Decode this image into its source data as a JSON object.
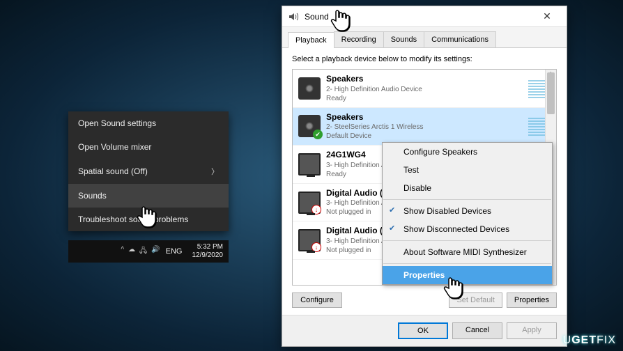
{
  "dark_menu": {
    "items": [
      {
        "label": "Open Sound settings"
      },
      {
        "label": "Open Volume mixer"
      },
      {
        "label": "Spatial sound (Off)",
        "arrow": true
      },
      {
        "label": "Sounds",
        "hover": true
      },
      {
        "label": "Troubleshoot sound problems"
      }
    ]
  },
  "taskbar": {
    "lang": "ENG",
    "time": "5:32 PM",
    "date": "12/9/2020"
  },
  "sound_dialog": {
    "title": "Sound",
    "tabs": [
      "Playback",
      "Recording",
      "Sounds",
      "Communications"
    ],
    "active_tab": 0,
    "instruction": "Select a playback device below to modify its settings:",
    "devices": [
      {
        "name": "Speakers",
        "sub1": "2- High Definition Audio Device",
        "sub2": "Ready",
        "icon": "speaker",
        "meter": true
      },
      {
        "name": "Speakers",
        "sub1": "2- SteelSeries Arctis 1 Wireless",
        "sub2": "Default Device",
        "icon": "speaker",
        "meter": true,
        "selected": true,
        "badge": "check"
      },
      {
        "name": "24G1WG4",
        "sub1": "3- High Definition Audio Device",
        "sub2": "Ready",
        "icon": "monitor",
        "meter": true
      },
      {
        "name": "Digital Audio (S/PDIF)",
        "sub1": "3- High Definition Audio Device",
        "sub2": "Not plugged in",
        "icon": "monitor",
        "badge": "down"
      },
      {
        "name": "Digital Audio (S/PDIF)",
        "sub1": "3- High Definition Audio Device",
        "sub2": "Not plugged in",
        "icon": "monitor",
        "badge": "down"
      }
    ],
    "buttons": {
      "configure": "Configure",
      "set_default": "Set Default",
      "properties": "Properties",
      "ok": "OK",
      "cancel": "Cancel",
      "apply": "Apply"
    }
  },
  "light_menu": {
    "items": [
      {
        "label": "Configure Speakers"
      },
      {
        "label": "Test"
      },
      {
        "label": "Disable"
      },
      {
        "sep": true
      },
      {
        "label": "Show Disabled Devices",
        "check": true
      },
      {
        "label": "Show Disconnected Devices",
        "check": true
      },
      {
        "sep": true
      },
      {
        "label": "About Software MIDI Synthesizer"
      },
      {
        "sep": true
      },
      {
        "label": "Properties",
        "hover": true
      }
    ]
  },
  "watermark": "UGETFIX"
}
